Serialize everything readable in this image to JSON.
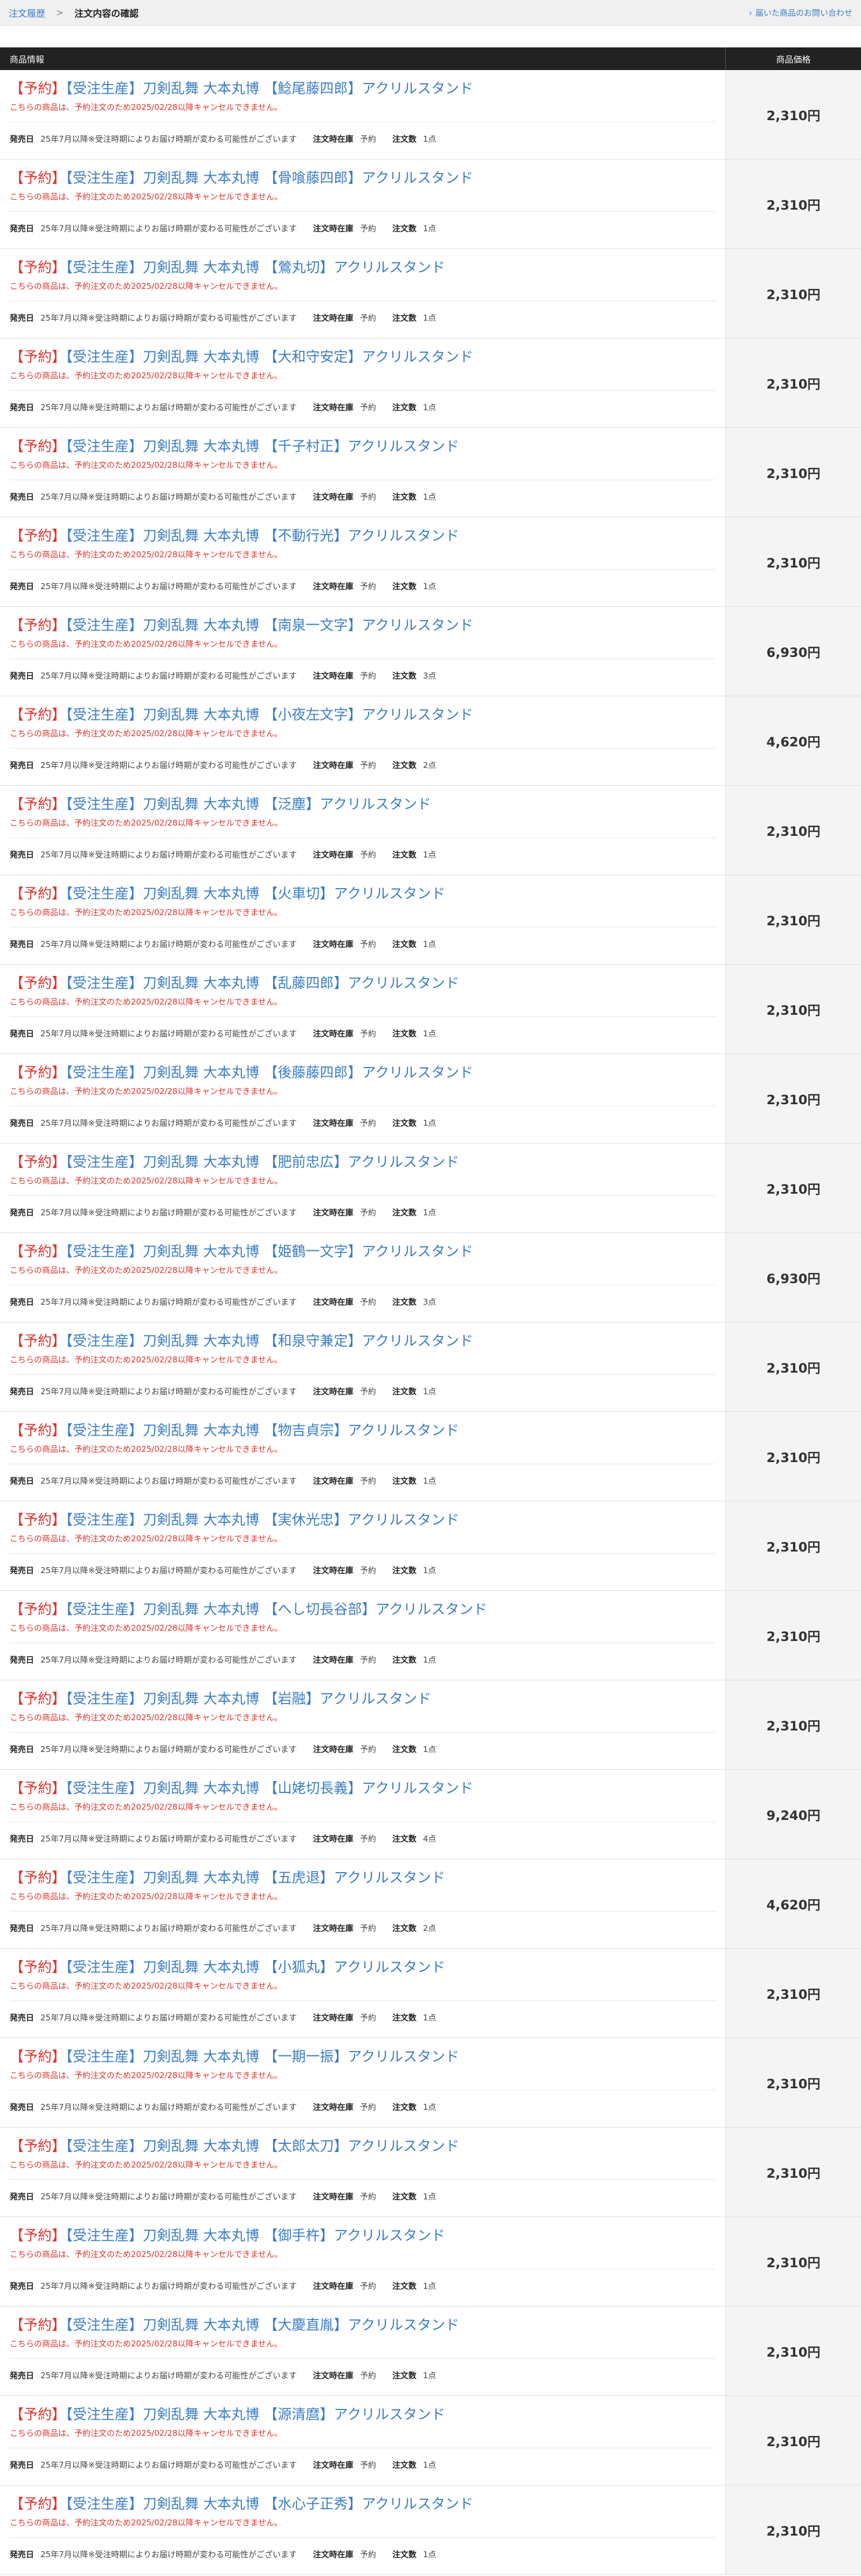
{
  "header": {
    "breadcrumb_parent": "注文履歴",
    "breadcrumb_sep": ">",
    "breadcrumb_current": "注文内容の確認",
    "help_link": "届いた商品のお問い合わせ"
  },
  "table": {
    "col_info": "商品情報",
    "col_price": "商品価格"
  },
  "labels": {
    "release": "発売日",
    "stock": "注文時在庫",
    "qty": "注文数"
  },
  "items": [
    {
      "tag": "【予約】",
      "name": "【受注生産】刀剣乱舞 大本丸博 【鯰尾藤四郎】アクリルスタンド",
      "note": "こちらの商品は、予約注文のため2025/02/28以降キャンセルできません。",
      "release": "25年7月以降※受注時期によりお届け時期が変わる可能性がございます",
      "stock": "予約",
      "qty": "1点",
      "price": "2,310円"
    },
    {
      "tag": "【予約】",
      "name": "【受注生産】刀剣乱舞 大本丸博 【骨喰藤四郎】アクリルスタンド",
      "note": "こちらの商品は、予約注文のため2025/02/28以降キャンセルできません。",
      "release": "25年7月以降※受注時期によりお届け時期が変わる可能性がございます",
      "stock": "予約",
      "qty": "1点",
      "price": "2,310円"
    },
    {
      "tag": "【予約】",
      "name": "【受注生産】刀剣乱舞 大本丸博 【鶯丸切】アクリルスタンド",
      "note": "こちらの商品は、予約注文のため2025/02/28以降キャンセルできません。",
      "release": "25年7月以降※受注時期によりお届け時期が変わる可能性がございます",
      "stock": "予約",
      "qty": "1点",
      "price": "2,310円"
    },
    {
      "tag": "【予約】",
      "name": "【受注生産】刀剣乱舞 大本丸博 【大和守安定】アクリルスタンド",
      "note": "こちらの商品は、予約注文のため2025/02/28以降キャンセルできません。",
      "release": "25年7月以降※受注時期によりお届け時期が変わる可能性がございます",
      "stock": "予約",
      "qty": "1点",
      "price": "2,310円"
    },
    {
      "tag": "【予約】",
      "name": "【受注生産】刀剣乱舞 大本丸博 【千子村正】アクリルスタンド",
      "note": "こちらの商品は、予約注文のため2025/02/28以降キャンセルできません。",
      "release": "25年7月以降※受注時期によりお届け時期が変わる可能性がございます",
      "stock": "予約",
      "qty": "1点",
      "price": "2,310円"
    },
    {
      "tag": "【予約】",
      "name": "【受注生産】刀剣乱舞 大本丸博 【不動行光】アクリルスタンド",
      "note": "こちらの商品は、予約注文のため2025/02/28以降キャンセルできません。",
      "release": "25年7月以降※受注時期によりお届け時期が変わる可能性がございます",
      "stock": "予約",
      "qty": "1点",
      "price": "2,310円"
    },
    {
      "tag": "【予約】",
      "name": "【受注生産】刀剣乱舞 大本丸博 【南泉一文字】アクリルスタンド",
      "note": "こちらの商品は、予約注文のため2025/02/28以降キャンセルできません。",
      "release": "25年7月以降※受注時期によりお届け時期が変わる可能性がございます",
      "stock": "予約",
      "qty": "3点",
      "price": "6,930円"
    },
    {
      "tag": "【予約】",
      "name": "【受注生産】刀剣乱舞 大本丸博 【小夜左文字】アクリルスタンド",
      "note": "こちらの商品は、予約注文のため2025/02/28以降キャンセルできません。",
      "release": "25年7月以降※受注時期によりお届け時期が変わる可能性がございます",
      "stock": "予約",
      "qty": "2点",
      "price": "4,620円"
    },
    {
      "tag": "【予約】",
      "name": "【受注生産】刀剣乱舞 大本丸博 【泛塵】アクリルスタンド",
      "note": "こちらの商品は、予約注文のため2025/02/28以降キャンセルできません。",
      "release": "25年7月以降※受注時期によりお届け時期が変わる可能性がございます",
      "stock": "予約",
      "qty": "1点",
      "price": "2,310円"
    },
    {
      "tag": "【予約】",
      "name": "【受注生産】刀剣乱舞 大本丸博 【火車切】アクリルスタンド",
      "note": "こちらの商品は、予約注文のため2025/02/28以降キャンセルできません。",
      "release": "25年7月以降※受注時期によりお届け時期が変わる可能性がございます",
      "stock": "予約",
      "qty": "1点",
      "price": "2,310円"
    },
    {
      "tag": "【予約】",
      "name": "【受注生産】刀剣乱舞 大本丸博 【乱藤四郎】アクリルスタンド",
      "note": "こちらの商品は、予約注文のため2025/02/28以降キャンセルできません。",
      "release": "25年7月以降※受注時期によりお届け時期が変わる可能性がございます",
      "stock": "予約",
      "qty": "1点",
      "price": "2,310円"
    },
    {
      "tag": "【予約】",
      "name": "【受注生産】刀剣乱舞 大本丸博 【後藤藤四郎】アクリルスタンド",
      "note": "こちらの商品は、予約注文のため2025/02/28以降キャンセルできません。",
      "release": "25年7月以降※受注時期によりお届け時期が変わる可能性がございます",
      "stock": "予約",
      "qty": "1点",
      "price": "2,310円"
    },
    {
      "tag": "【予約】",
      "name": "【受注生産】刀剣乱舞 大本丸博 【肥前忠広】アクリルスタンド",
      "note": "こちらの商品は、予約注文のため2025/02/28以降キャンセルできません。",
      "release": "25年7月以降※受注時期によりお届け時期が変わる可能性がございます",
      "stock": "予約",
      "qty": "1点",
      "price": "2,310円"
    },
    {
      "tag": "【予約】",
      "name": "【受注生産】刀剣乱舞 大本丸博 【姫鶴一文字】アクリルスタンド",
      "note": "こちらの商品は、予約注文のため2025/02/28以降キャンセルできません。",
      "release": "25年7月以降※受注時期によりお届け時期が変わる可能性がございます",
      "stock": "予約",
      "qty": "3点",
      "price": "6,930円"
    },
    {
      "tag": "【予約】",
      "name": "【受注生産】刀剣乱舞 大本丸博 【和泉守兼定】アクリルスタンド",
      "note": "こちらの商品は、予約注文のため2025/02/28以降キャンセルできません。",
      "release": "25年7月以降※受注時期によりお届け時期が変わる可能性がございます",
      "stock": "予約",
      "qty": "1点",
      "price": "2,310円"
    },
    {
      "tag": "【予約】",
      "name": "【受注生産】刀剣乱舞 大本丸博 【物吉貞宗】アクリルスタンド",
      "note": "こちらの商品は、予約注文のため2025/02/28以降キャンセルできません。",
      "release": "25年7月以降※受注時期によりお届け時期が変わる可能性がございます",
      "stock": "予約",
      "qty": "1点",
      "price": "2,310円"
    },
    {
      "tag": "【予約】",
      "name": "【受注生産】刀剣乱舞 大本丸博 【実休光忠】アクリルスタンド",
      "note": "こちらの商品は、予約注文のため2025/02/28以降キャンセルできません。",
      "release": "25年7月以降※受注時期によりお届け時期が変わる可能性がございます",
      "stock": "予約",
      "qty": "1点",
      "price": "2,310円"
    },
    {
      "tag": "【予約】",
      "name": "【受注生産】刀剣乱舞 大本丸博 【へし切長谷部】アクリルスタンド",
      "note": "こちらの商品は、予約注文のため2025/02/28以降キャンセルできません。",
      "release": "25年7月以降※受注時期によりお届け時期が変わる可能性がございます",
      "stock": "予約",
      "qty": "1点",
      "price": "2,310円"
    },
    {
      "tag": "【予約】",
      "name": "【受注生産】刀剣乱舞 大本丸博 【岩融】アクリルスタンド",
      "note": "こちらの商品は、予約注文のため2025/02/28以降キャンセルできません。",
      "release": "25年7月以降※受注時期によりお届け時期が変わる可能性がございます",
      "stock": "予約",
      "qty": "1点",
      "price": "2,310円"
    },
    {
      "tag": "【予約】",
      "name": "【受注生産】刀剣乱舞 大本丸博 【山姥切長義】アクリルスタンド",
      "note": "こちらの商品は、予約注文のため2025/02/28以降キャンセルできません。",
      "release": "25年7月以降※受注時期によりお届け時期が変わる可能性がございます",
      "stock": "予約",
      "qty": "4点",
      "price": "9,240円"
    },
    {
      "tag": "【予約】",
      "name": "【受注生産】刀剣乱舞 大本丸博 【五虎退】アクリルスタンド",
      "note": "こちらの商品は、予約注文のため2025/02/28以降キャンセルできません。",
      "release": "25年7月以降※受注時期によりお届け時期が変わる可能性がございます",
      "stock": "予約",
      "qty": "2点",
      "price": "4,620円"
    },
    {
      "tag": "【予約】",
      "name": "【受注生産】刀剣乱舞 大本丸博 【小狐丸】アクリルスタンド",
      "note": "こちらの商品は、予約注文のため2025/02/28以降キャンセルできません。",
      "release": "25年7月以降※受注時期によりお届け時期が変わる可能性がございます",
      "stock": "予約",
      "qty": "1点",
      "price": "2,310円"
    },
    {
      "tag": "【予約】",
      "name": "【受注生産】刀剣乱舞 大本丸博 【一期一振】アクリルスタンド",
      "note": "こちらの商品は、予約注文のため2025/02/28以降キャンセルできません。",
      "release": "25年7月以降※受注時期によりお届け時期が変わる可能性がございます",
      "stock": "予約",
      "qty": "1点",
      "price": "2,310円"
    },
    {
      "tag": "【予約】",
      "name": "【受注生産】刀剣乱舞 大本丸博 【太郎太刀】アクリルスタンド",
      "note": "こちらの商品は、予約注文のため2025/02/28以降キャンセルできません。",
      "release": "25年7月以降※受注時期によりお届け時期が変わる可能性がございます",
      "stock": "予約",
      "qty": "1点",
      "price": "2,310円"
    },
    {
      "tag": "【予約】",
      "name": "【受注生産】刀剣乱舞 大本丸博 【御手杵】アクリルスタンド",
      "note": "こちらの商品は、予約注文のため2025/02/28以降キャンセルできません。",
      "release": "25年7月以降※受注時期によりお届け時期が変わる可能性がございます",
      "stock": "予約",
      "qty": "1点",
      "price": "2,310円"
    },
    {
      "tag": "【予約】",
      "name": "【受注生産】刀剣乱舞 大本丸博 【大慶直胤】アクリルスタンド",
      "note": "こちらの商品は、予約注文のため2025/02/28以降キャンセルできません。",
      "release": "25年7月以降※受注時期によりお届け時期が変わる可能性がございます",
      "stock": "予約",
      "qty": "1点",
      "price": "2,310円"
    },
    {
      "tag": "【予約】",
      "name": "【受注生産】刀剣乱舞 大本丸博 【源清麿】アクリルスタンド",
      "note": "こちらの商品は、予約注文のため2025/02/28以降キャンセルできません。",
      "release": "25年7月以降※受注時期によりお届け時期が変わる可能性がございます",
      "stock": "予約",
      "qty": "1点",
      "price": "2,310円"
    },
    {
      "tag": "【予約】",
      "name": "【受注生産】刀剣乱舞 大本丸博 【水心子正秀】アクリルスタンド",
      "note": "こちらの商品は、予約注文のため2025/02/28以降キャンセルできません。",
      "release": "25年7月以降※受注時期によりお届け時期が変わる可能性がございます",
      "stock": "予約",
      "qty": "1点",
      "price": "2,310円"
    }
  ]
}
